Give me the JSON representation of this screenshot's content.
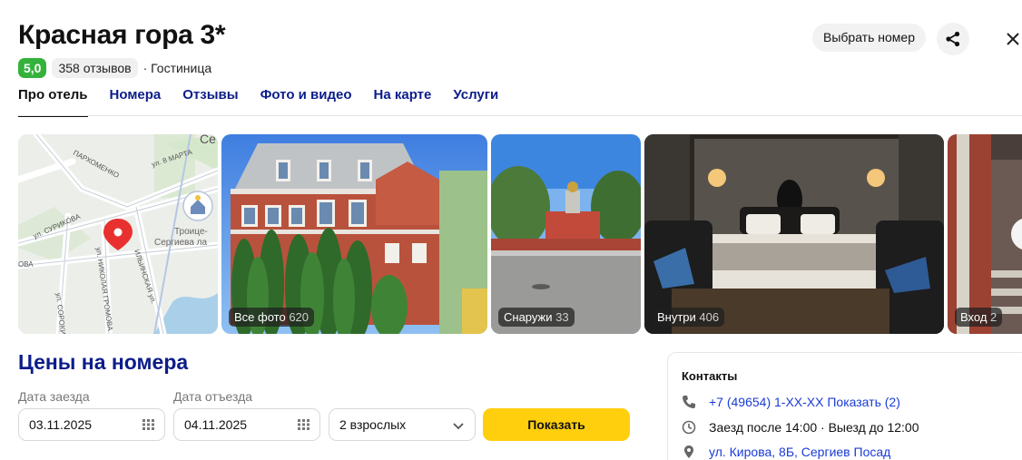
{
  "header": {
    "title": "Красная гора 3*",
    "rating": "5,0",
    "reviews": "358 отзывов",
    "type": "· Гостиница",
    "choose_room": "Выбрать номер"
  },
  "tabs": [
    {
      "label": "Про отель"
    },
    {
      "label": "Номера"
    },
    {
      "label": "Отзывы"
    },
    {
      "label": "Фото и видео"
    },
    {
      "label": "На карте"
    },
    {
      "label": "Услуги"
    }
  ],
  "map": {
    "streets": [
      "ПАРХОМЕНКО",
      "ул. 8 МАРТА",
      "ул. СУРИКОВА",
      "ул. СОРОКИНА",
      "ул. НИКОЛАЯ ГРОМОВА",
      "ИЛЬИНСКАЯ ул.",
      "ОВА",
      "Се"
    ],
    "poi": [
      "Троице-",
      "Сергиева ла"
    ]
  },
  "gallery": [
    {
      "label": "Все фото",
      "count": "620"
    },
    {
      "label": "Снаружи",
      "count": "33"
    },
    {
      "label": "Внутри",
      "count": "406"
    },
    {
      "label": "Вход",
      "count": "2"
    }
  ],
  "booking": {
    "title": "Цены на номера",
    "checkin_label": "Дата заезда",
    "checkout_label": "Дата отъезда",
    "checkin": "03.11.2025",
    "checkout": "04.11.2025",
    "guests": "2 взрослых",
    "show": "Показать"
  },
  "contacts": {
    "title": "Контакты",
    "phone": "+7 (49654) 1-XX-XX Показать (2)",
    "hours": "Заезд после 14:00 · Выезд до 12:00",
    "address": "ул. Кирова, 8Б, Сергиев Посад"
  },
  "colors": {
    "accent": "#0c1d8a",
    "rating": "#34b23c",
    "button": "#ffcf0d",
    "link": "#1a3bd6"
  }
}
